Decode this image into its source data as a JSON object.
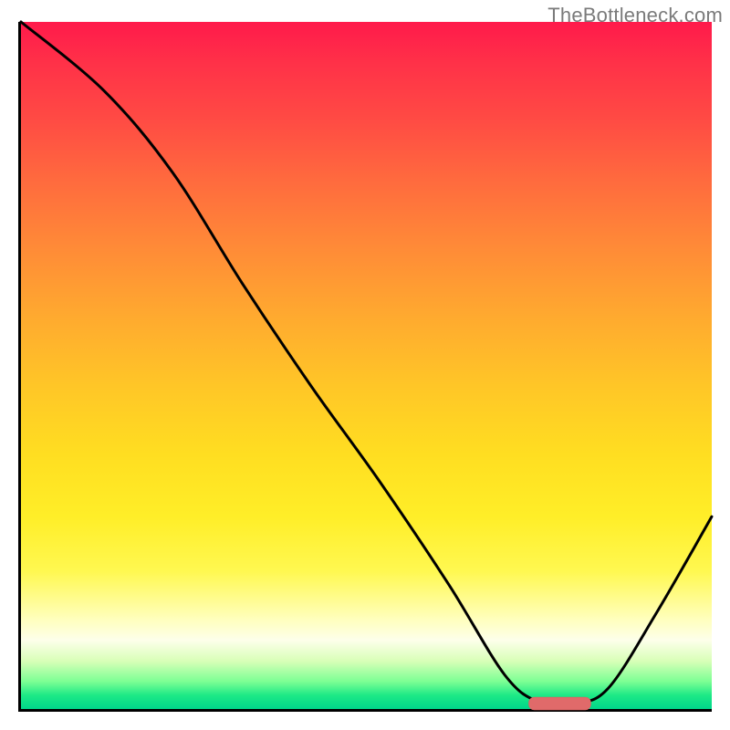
{
  "watermark": "TheBottleneck.com",
  "chart_data": {
    "type": "line",
    "title": "",
    "xlabel": "",
    "ylabel": "",
    "xlim": [
      0,
      100
    ],
    "ylim": [
      0,
      100
    ],
    "grid": false,
    "legend": false,
    "background": "gradient-red-yellow-green",
    "series": [
      {
        "name": "bottleneck-curve",
        "x": [
          0,
          12,
          22,
          32,
          42,
          52,
          62,
          70,
          75,
          80,
          85,
          92,
          100
        ],
        "y": [
          100,
          90,
          78,
          62,
          47,
          33,
          18,
          5,
          1,
          0.8,
          3,
          14,
          28
        ]
      }
    ],
    "markers": [
      {
        "name": "optimal-point",
        "shape": "rounded-bar",
        "x_center": 78,
        "x_halfwidth": 4.5,
        "y": 0.8,
        "color": "#e06a6a"
      }
    ],
    "annotations": []
  }
}
